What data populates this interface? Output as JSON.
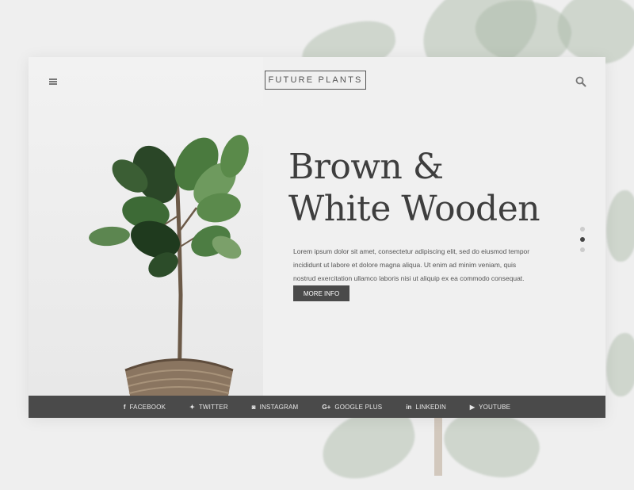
{
  "header": {
    "logo_text": "FUTURE PLANTS",
    "menu_icon": "hamburger-menu-icon",
    "search_icon": "search-icon"
  },
  "hero": {
    "title_line1": "Brown &",
    "title_line2": "White Wooden",
    "description": "Lorem ipsum dolor sit amet, consectetur adipiscing elit, sed do eiusmod tempor incididunt ut labore et dolore magna aliqua. Ut enim ad minim veniam, quis nostrud exercitation ullamco laboris nisi ut aliquip ex ea commodo consequat.",
    "button_label": "MORE INFO"
  },
  "pagination": {
    "count": 3,
    "active_index": 1
  },
  "social": [
    {
      "icon": "facebook-icon",
      "glyph": "f",
      "label": "FACEBOOK"
    },
    {
      "icon": "twitter-icon",
      "glyph": "✦",
      "label": "TWITTER"
    },
    {
      "icon": "instagram-icon",
      "glyph": "◙",
      "label": "INSTAGRAM"
    },
    {
      "icon": "google-plus-icon",
      "glyph": "G+",
      "label": "GOOGLE PLUS"
    },
    {
      "icon": "linkedin-icon",
      "glyph": "in",
      "label": "LINKEDIN"
    },
    {
      "icon": "youtube-icon",
      "glyph": "▶",
      "label": "YOUTUBE"
    }
  ],
  "colors": {
    "page_bg": "#efefef",
    "card_bg": "#f0f0f0",
    "dark_gray": "#4a4a4a",
    "leaf_green": "#2f4a2a",
    "pot_brown": "#8a7560"
  }
}
